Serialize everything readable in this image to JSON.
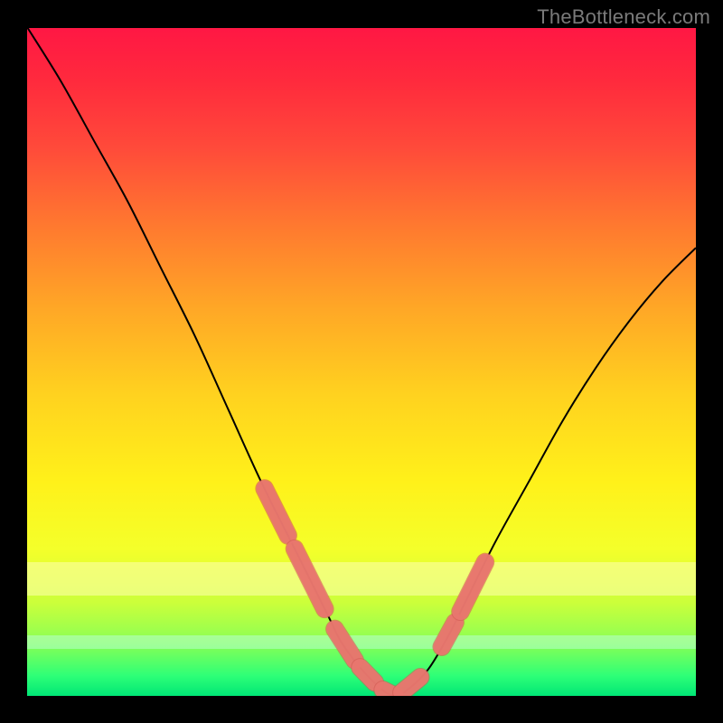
{
  "watermark": "TheBottleneck.com",
  "colors": {
    "pale_yellow_band": "#ffffb0",
    "mint_band": "#b6ffd0",
    "curve_stroke": "#000000",
    "marker_fill": "#e9776f",
    "marker_stroke": "#d25b53"
  },
  "chart_data": {
    "type": "line",
    "title": "",
    "xlabel": "",
    "ylabel": "",
    "xlim": [
      0,
      100
    ],
    "ylim": [
      0,
      100
    ],
    "x": [
      0,
      5,
      10,
      15,
      20,
      25,
      30,
      35,
      40,
      45,
      47,
      50,
      53,
      55,
      57,
      60,
      63,
      66,
      70,
      75,
      80,
      85,
      90,
      95,
      100
    ],
    "values": [
      100,
      92,
      83,
      74,
      64,
      54,
      43,
      32,
      22,
      12,
      8,
      4,
      1,
      0,
      1,
      4,
      9,
      15,
      23,
      32,
      41,
      49,
      56,
      62,
      67
    ],
    "bands": [
      {
        "label": "pale",
        "y0": 80,
        "y1": 85
      },
      {
        "label": "mint",
        "y0": 91,
        "y1": 93
      }
    ],
    "markers": {
      "segments": [
        {
          "x0": 35.5,
          "x1": 39.0
        },
        {
          "x0": 40.0,
          "x1": 44.5
        },
        {
          "x0": 46.0,
          "x1": 49.0
        },
        {
          "x0": 49.8,
          "x1": 52.0
        },
        {
          "x0": 53.2,
          "x1": 55.0
        },
        {
          "x0": 56.0,
          "x1": 58.8
        },
        {
          "x0": 62.0,
          "x1": 64.0
        },
        {
          "x0": 64.8,
          "x1": 68.5
        }
      ],
      "width": 2.8
    }
  }
}
